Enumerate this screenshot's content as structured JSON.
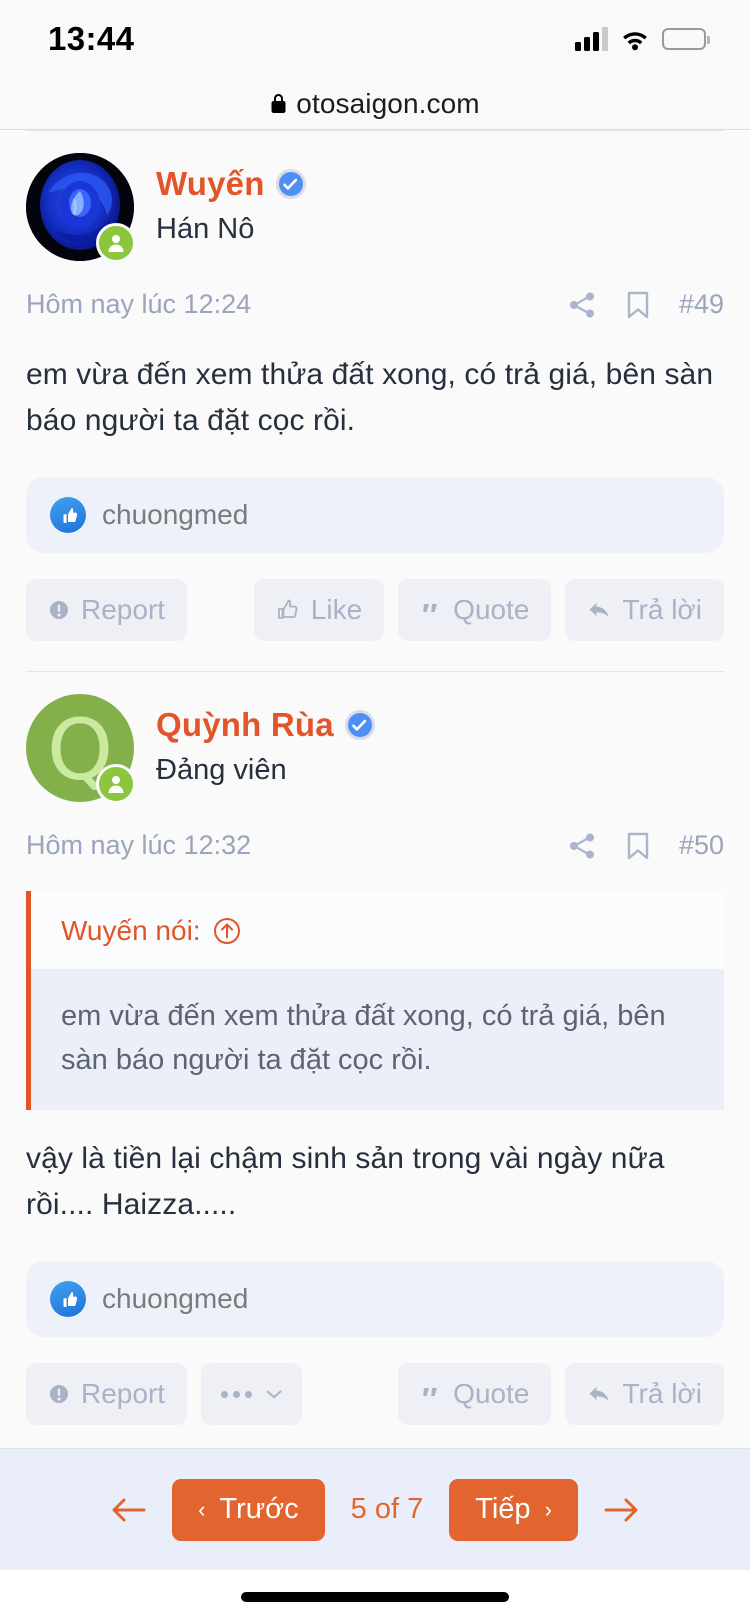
{
  "statusbar": {
    "time": "13:44",
    "cellular_icon": "cellular-signal-icon",
    "wifi_icon": "wifi-icon",
    "battery_icon": "battery-icon"
  },
  "browser": {
    "lock_icon": "lock-icon",
    "host": "otosaigon.com"
  },
  "colors": {
    "accent_orange": "#e2552a",
    "button_orange": "#e2642f",
    "verified_blue": "#4e8ff5",
    "muted": "#9aa4bb",
    "page_bg": "#fafafa",
    "footer_bg": "#e9eefa"
  },
  "posts": [
    {
      "username": "Wuyến",
      "verified": true,
      "user_title": "Hán Nô",
      "avatar_type": "image",
      "avatar_label": "blue-rose-avatar",
      "timestamp": "Hôm nay lúc 12:24",
      "share_icon": "share-icon",
      "bookmark_icon": "bookmark-icon",
      "post_number": "#49",
      "body": "em vừa đến xem thửa đất xong, có trả giá, bên sàn báo người ta đặt cọc rồi.",
      "reaction": {
        "icon": "thumbs-up-icon",
        "name": "chuongmed"
      },
      "actions": {
        "report": "Report",
        "like": "Like",
        "quote": "Quote",
        "reply": "Trả lời"
      }
    },
    {
      "username": "Quỳnh Rùa",
      "verified": true,
      "user_title": "Đảng viên",
      "avatar_type": "letter",
      "avatar_letter": "Q",
      "timestamp": "Hôm nay lúc 12:32",
      "share_icon": "share-icon",
      "bookmark_icon": "bookmark-icon",
      "post_number": "#50",
      "quote": {
        "header": "Wuyến nói:",
        "jump_icon": "arrow-up-circle-icon",
        "text": "em vừa đến xem thửa đất xong, có trả giá, bên sàn báo người ta đặt cọc rồi."
      },
      "body": "vậy là tiền lại chậm sinh sản trong vài ngày nữa rồi.... Haizza.....",
      "reaction": {
        "icon": "thumbs-up-icon",
        "name": "chuongmed"
      },
      "actions": {
        "report": "Report",
        "more": "…",
        "quote": "Quote",
        "reply": "Trả lời"
      }
    }
  ],
  "pagination": {
    "first_arrow_icon": "arrow-left-icon",
    "prev_label": "Trước",
    "prev_chevron": "‹",
    "counter": "5 of 7",
    "next_label": "Tiếp",
    "next_chevron": "›",
    "last_arrow_icon": "arrow-right-icon"
  }
}
